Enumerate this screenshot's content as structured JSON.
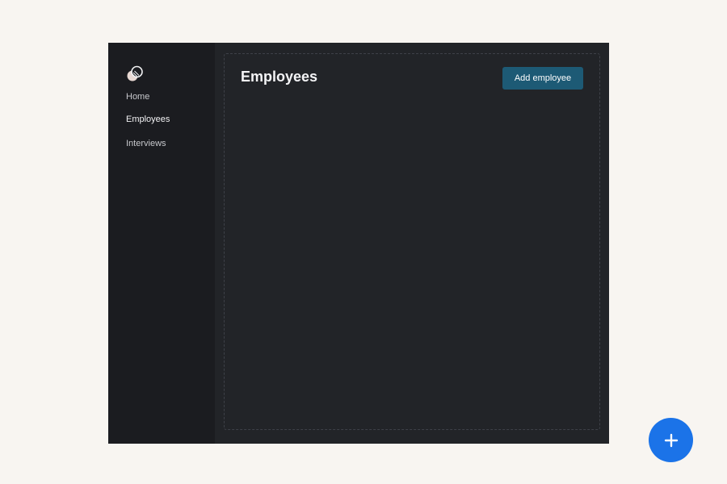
{
  "sidebar": {
    "logo_icon": "overlapping-circles-logo-icon",
    "items": [
      {
        "label": "Home",
        "active": false
      },
      {
        "label": "Employees",
        "active": true
      },
      {
        "label": "Interviews",
        "active": false
      }
    ]
  },
  "main": {
    "title": "Employees",
    "add_button_label": "Add employee"
  },
  "fab": {
    "icon": "plus-icon"
  },
  "colors": {
    "page_background": "#f8f5f1",
    "sidebar_background": "#1b1c20",
    "main_background": "#222428",
    "primary_button": "#1d5a75",
    "fab": "#1b73e8"
  }
}
